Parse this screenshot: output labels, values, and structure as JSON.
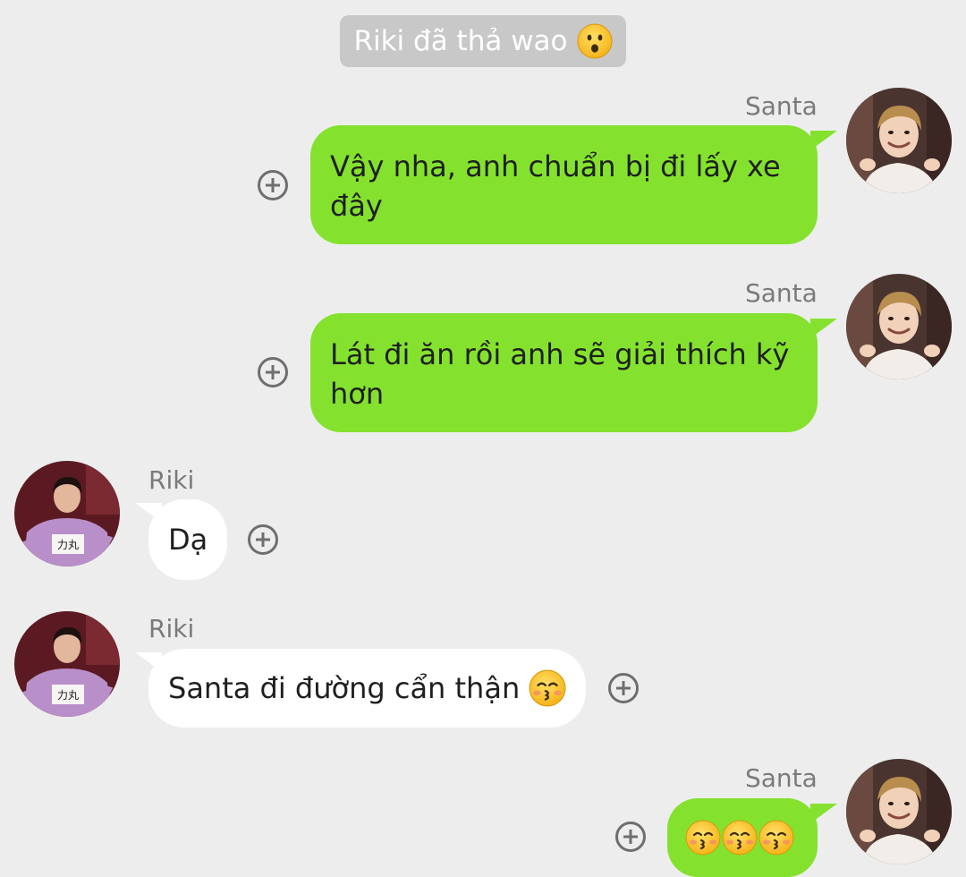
{
  "system_notice": {
    "text": "Riki đã thả wao",
    "emoji": "hushed-face-emoji"
  },
  "colors": {
    "background": "#ededed",
    "outgoing_bubble": "#84e22f",
    "incoming_bubble": "#ffffff",
    "system_pill": "#c8c8c8"
  },
  "messages": [
    {
      "sender": "Santa",
      "direction": "outgoing",
      "lines": [
        "Vậy nha, anh chuẩn bị đi lấy xe",
        "đây"
      ]
    },
    {
      "sender": "Santa",
      "direction": "outgoing",
      "lines": [
        "Lát đi ăn rồi anh sẽ giải thích kỹ",
        "hơn"
      ]
    },
    {
      "sender": "Riki",
      "direction": "incoming",
      "text": "Dạ"
    },
    {
      "sender": "Riki",
      "direction": "incoming",
      "text": "Santa đi đường cẩn thận",
      "emoji": "kissing-face-emoji"
    },
    {
      "sender": "Santa",
      "direction": "outgoing",
      "emojis": [
        "kissing-face-emoji",
        "kissing-face-emoji",
        "kissing-face-emoji"
      ]
    }
  ]
}
